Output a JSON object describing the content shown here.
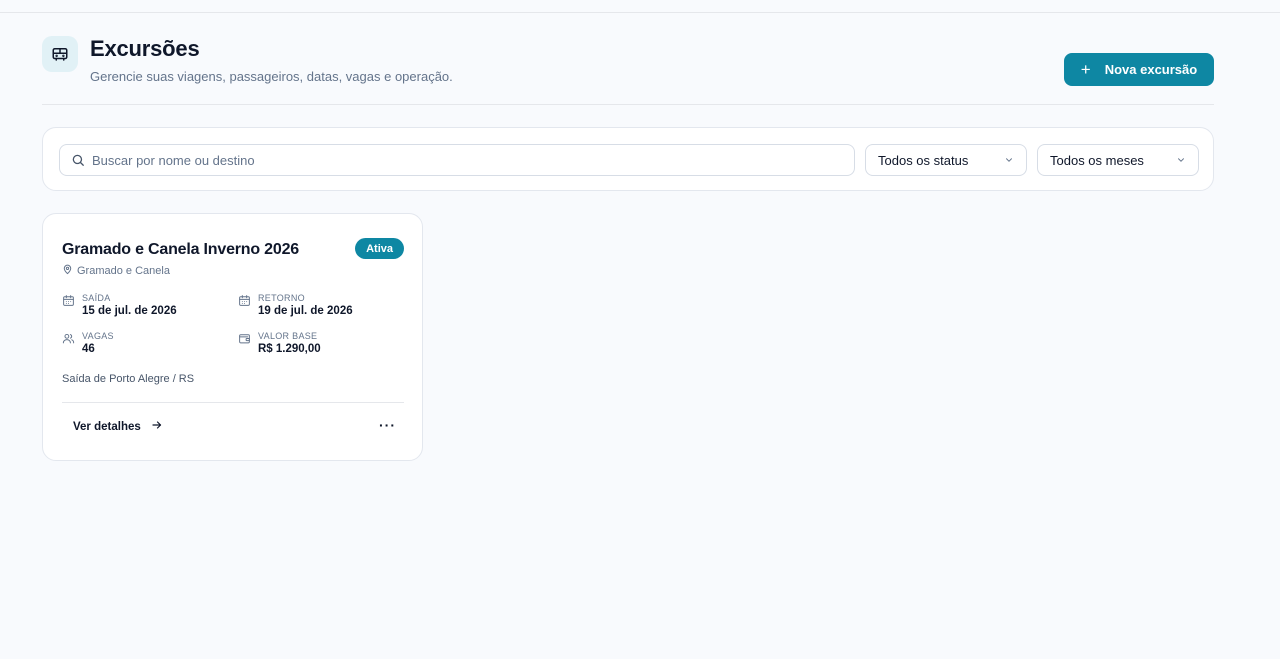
{
  "header": {
    "icon": "bus-icon",
    "title": "Excursões",
    "subtitle": "Gerencie suas viagens, passageiros, datas, vagas e operação.",
    "new_button_label": "Nova excursão"
  },
  "filters": {
    "search_placeholder": "Buscar por nome ou destino",
    "status_selected": "Todos os status",
    "month_selected": "Todos os meses"
  },
  "excursions": [
    {
      "title": "Gramado e Canela Inverno 2026",
      "status": "Ativa",
      "location": "Gramado e Canela",
      "departure_label": "SAÍDA",
      "departure_date": "15 de jul. de 2026",
      "return_label": "RETORNO",
      "return_date": "19 de jul. de 2026",
      "seats_label": "VAGAS",
      "seats": "46",
      "price_label": "VALOR BASE",
      "price": "R$ 1.290,00",
      "departure_point": "Saída de Porto Alegre / RS",
      "details_label": "Ver detalhes",
      "more_label": "···"
    }
  ],
  "colors": {
    "accent": "#0e87a3",
    "background": "#f8fafd",
    "text": "#0f172a",
    "muted": "#64748b"
  }
}
